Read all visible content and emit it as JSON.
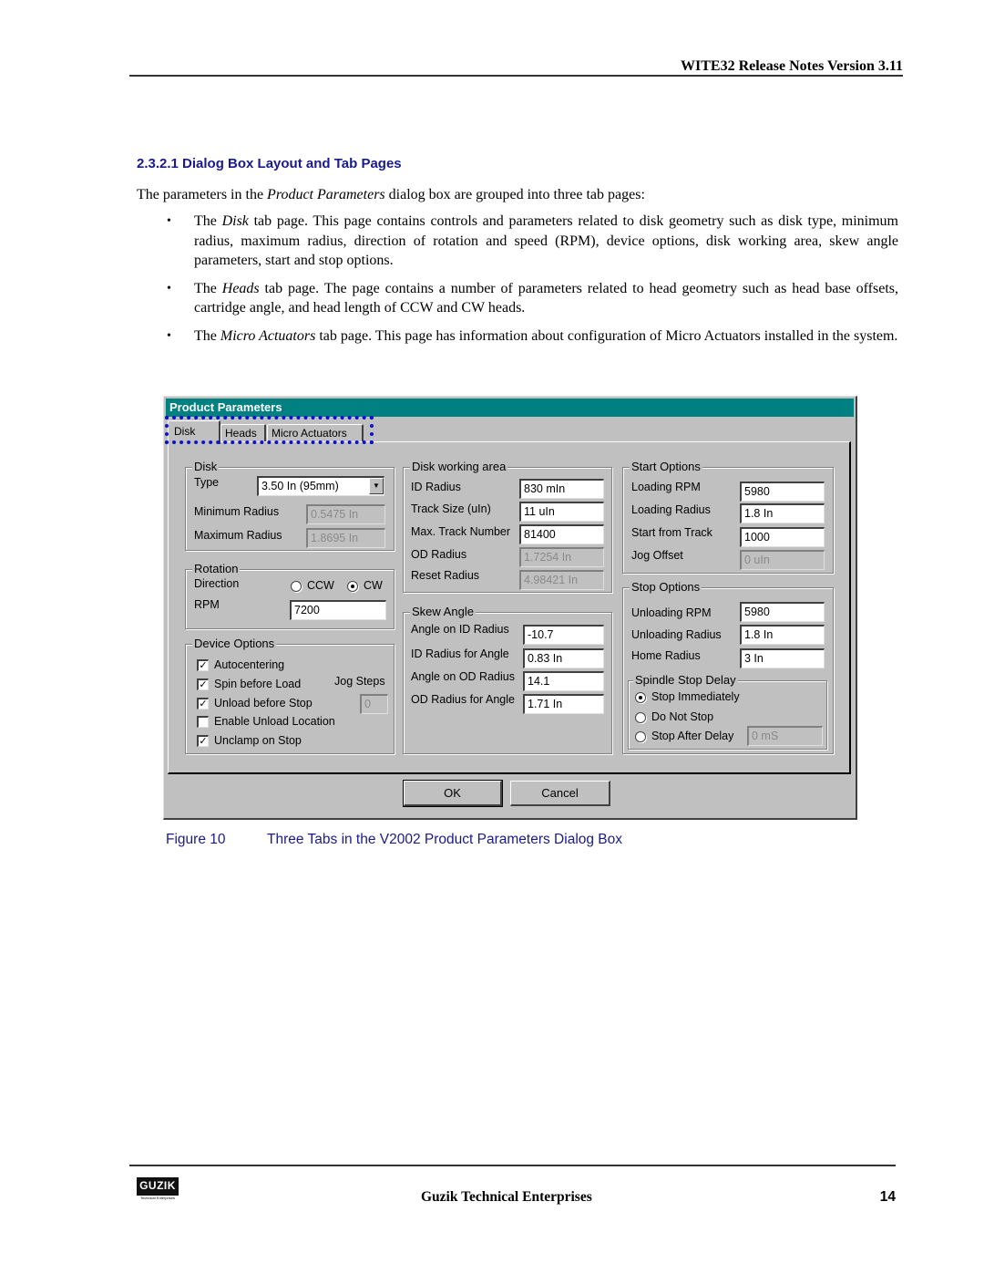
{
  "header": {
    "title": "WITE32 Release Notes Version 3.11"
  },
  "section": {
    "heading": "2.3.2.1  Dialog Box Layout and Tab Pages",
    "intro_before": "The parameters in the ",
    "intro_italic": "Product Parameters",
    "intro_after": " dialog box are grouped into three tab pages:",
    "bullets": [
      {
        "before": "The ",
        "italic": "Disk",
        "after": " tab page. This page contains controls and parameters related to disk geometry such as disk type, minimum radius, maximum radius, direction of rotation and speed (RPM), device options, disk working area, skew angle parameters, start and stop options."
      },
      {
        "before": "The ",
        "italic": "Heads",
        "after": " tab page. The page contains a number of parameters related to head geometry such as head base offsets, cartridge angle, and head length of CCW and CW heads."
      },
      {
        "before": "The ",
        "italic": "Micro Actuators",
        "after": " tab page. This page has information about configuration of Micro Actuators installed in the system."
      }
    ],
    "bullet_glyph": "•"
  },
  "dialog": {
    "title": "Product Parameters",
    "tabs": [
      {
        "label": "Disk",
        "active": true
      },
      {
        "label": "Heads"
      },
      {
        "label": "Micro Actuators"
      }
    ],
    "disk_group": {
      "title": "Disk",
      "type_label": "Type",
      "type_value": "3.50 In (95mm)",
      "dropdown_glyph": "▼",
      "min_radius_label": "Minimum Radius",
      "min_radius_value": "0.5475 In",
      "max_radius_label": "Maximum Radius",
      "max_radius_value": "1.8695 In"
    },
    "rotation_group": {
      "title": "Rotation",
      "direction_label": "Direction",
      "ccw_label": "CCW",
      "cw_label": "CW",
      "selected": "CW",
      "rpm_label": "RPM",
      "rpm_value": "7200"
    },
    "device_options": {
      "title": "Device Options",
      "checks": [
        {
          "label": "Autocentering",
          "checked": true
        },
        {
          "label": "Spin before Load",
          "checked": true
        },
        {
          "label": "Unload before Stop",
          "checked": true
        },
        {
          "label": "Enable Unload Location",
          "checked": false
        },
        {
          "label": "Unclamp on Stop",
          "checked": true
        }
      ],
      "check_glyph": "✓",
      "jog_steps_label": "Jog Steps",
      "jog_steps_value": "0"
    },
    "working_area": {
      "title": "Disk working area",
      "rows": [
        {
          "label": "ID Radius",
          "value": "830 mIn",
          "disabled": false
        },
        {
          "label": "Track Size (uIn)",
          "value": "11 uIn",
          "disabled": false
        },
        {
          "label": "Max. Track Number",
          "value": "81400",
          "disabled": false
        },
        {
          "label": "OD Radius",
          "value": "1.7254 In",
          "disabled": true
        },
        {
          "label": "Reset Radius",
          "value": "4.98421 In",
          "disabled": true
        }
      ]
    },
    "skew_angle": {
      "title": "Skew Angle",
      "rows": [
        {
          "label": "Angle on ID Radius",
          "value": "-10.7"
        },
        {
          "label": "ID Radius for Angle",
          "value": "0.83 In"
        },
        {
          "label": "Angle on OD Radius",
          "value": "14.1"
        },
        {
          "label": "OD Radius for Angle",
          "value": "1.71 In"
        }
      ]
    },
    "start_options": {
      "title": "Start Options",
      "rows": [
        {
          "label": "Loading RPM",
          "value": "5980",
          "disabled": false
        },
        {
          "label": "Loading Radius",
          "value": "1.8 In",
          "disabled": false
        },
        {
          "label": "Start from Track",
          "value": "1000",
          "disabled": false
        },
        {
          "label": "Jog Offset",
          "value": "0 uIn",
          "disabled": true
        }
      ]
    },
    "stop_options": {
      "title": "Stop Options",
      "rows": [
        {
          "label": "Unloading RPM",
          "value": "5980"
        },
        {
          "label": "Unloading Radius",
          "value": "1.8 In"
        },
        {
          "label": "Home Radius",
          "value": "3 In"
        }
      ],
      "spindle": {
        "title": "Spindle Stop Delay",
        "options": [
          {
            "label": "Stop Immediately",
            "selected": true
          },
          {
            "label": "Do Not Stop"
          },
          {
            "label": "Stop After Delay"
          }
        ],
        "delay_value": "0 mS"
      }
    },
    "ok_label": "OK",
    "cancel_label": "Cancel"
  },
  "figure": {
    "number": "Figure 10",
    "caption": "Three Tabs in the V2002 Product Parameters Dialog Box"
  },
  "footer": {
    "logo_text": "GUZIK",
    "logo_sub": "Technical Enterprises",
    "company": "Guzik Technical Enterprises",
    "page": "14"
  },
  "colors": {
    "heading": "#1a1a8c",
    "titlebar": "#008080",
    "focus": "#1010d0",
    "dialog_bg": "#c0c0c0"
  }
}
